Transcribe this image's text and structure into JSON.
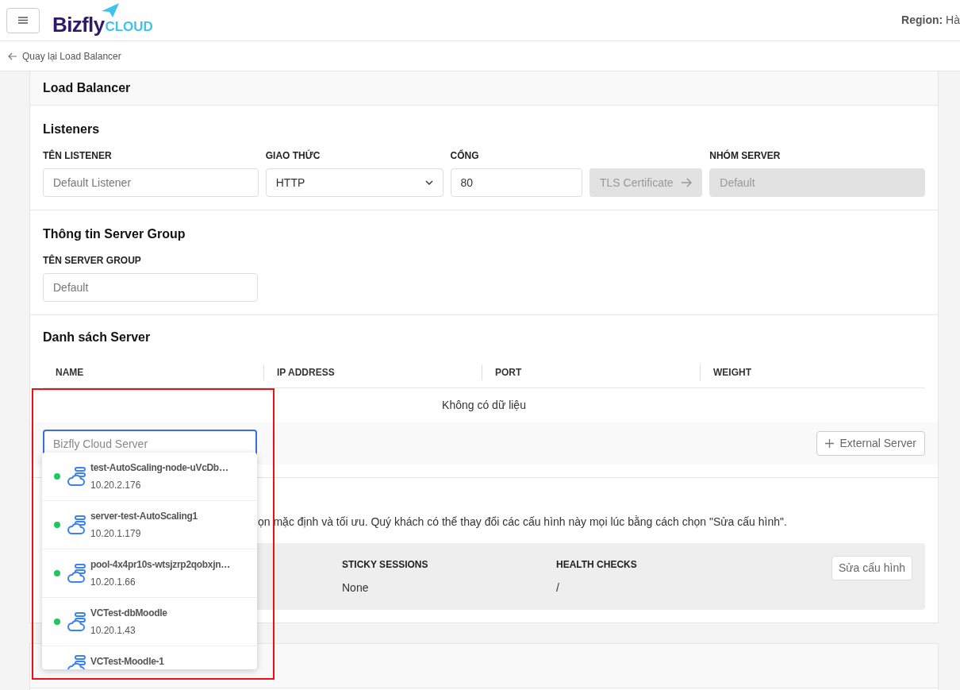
{
  "header": {
    "logo_word": "Bizfly",
    "logo_sub": "CLOUD",
    "region_label": "Region:",
    "region_value": "Hà"
  },
  "back_link": "Quay lại Load Balancer",
  "page_title": "Load Balancer",
  "listeners": {
    "title": "Listeners",
    "fields": [
      {
        "kind": "input",
        "label": "TÊN LISTENER",
        "placeholder": "Default Listener",
        "disabled": false
      },
      {
        "kind": "select",
        "label": "GIAO THỨC",
        "value": "HTTP",
        "disabled": false
      },
      {
        "kind": "input",
        "label": "CỔNG",
        "value": "80",
        "disabled": false
      },
      {
        "kind": "button",
        "text": "TLS Certificate",
        "disabled": true
      },
      {
        "kind": "input",
        "label": "NHÓM SERVER",
        "placeholder": "Default",
        "disabled": true
      }
    ]
  },
  "server_group": {
    "title": "Thông tin Server Group",
    "label": "TÊN SERVER GROUP",
    "placeholder": "Default"
  },
  "server_list": {
    "title": "Danh sách Server",
    "columns": [
      "NAME",
      "IP ADDRESS",
      "PORT",
      "WEIGHT"
    ],
    "empty_text": "Không có dữ liệu",
    "search": {
      "placeholder": "Bizfly Cloud Server"
    },
    "external_button": "External Server"
  },
  "dropdown": [
    {
      "name": "test-AutoScaling-node-uVcDb…",
      "ip": "10.20.2.176",
      "color": "#22c55e"
    },
    {
      "name": "server-test-AutoScaling1",
      "ip": "10.20.1.179",
      "color": "#22c55e"
    },
    {
      "name": "pool-4x4pr10s-wtsjzrp2qobxjn…",
      "ip": "10.20.1.66",
      "color": "#22c55e"
    },
    {
      "name": "VCTest-dbMoodle",
      "ip": "10.20.1.43",
      "color": "#22c55e"
    },
    {
      "name": "VCTest-Moodle-1"
    }
  ],
  "config": {
    "description": "ọn mặc định và tối ưu. Quý khách có thể thay đổi các cấu hình này mọi lúc bằng cách chọn \"Sửa cấu hình\".",
    "items": [
      {
        "label": "STICKY SESSIONS",
        "value": "None"
      },
      {
        "label": "HEALTH CHECKS",
        "value": "/"
      }
    ],
    "edit_button": "Sửa cấu hình"
  }
}
